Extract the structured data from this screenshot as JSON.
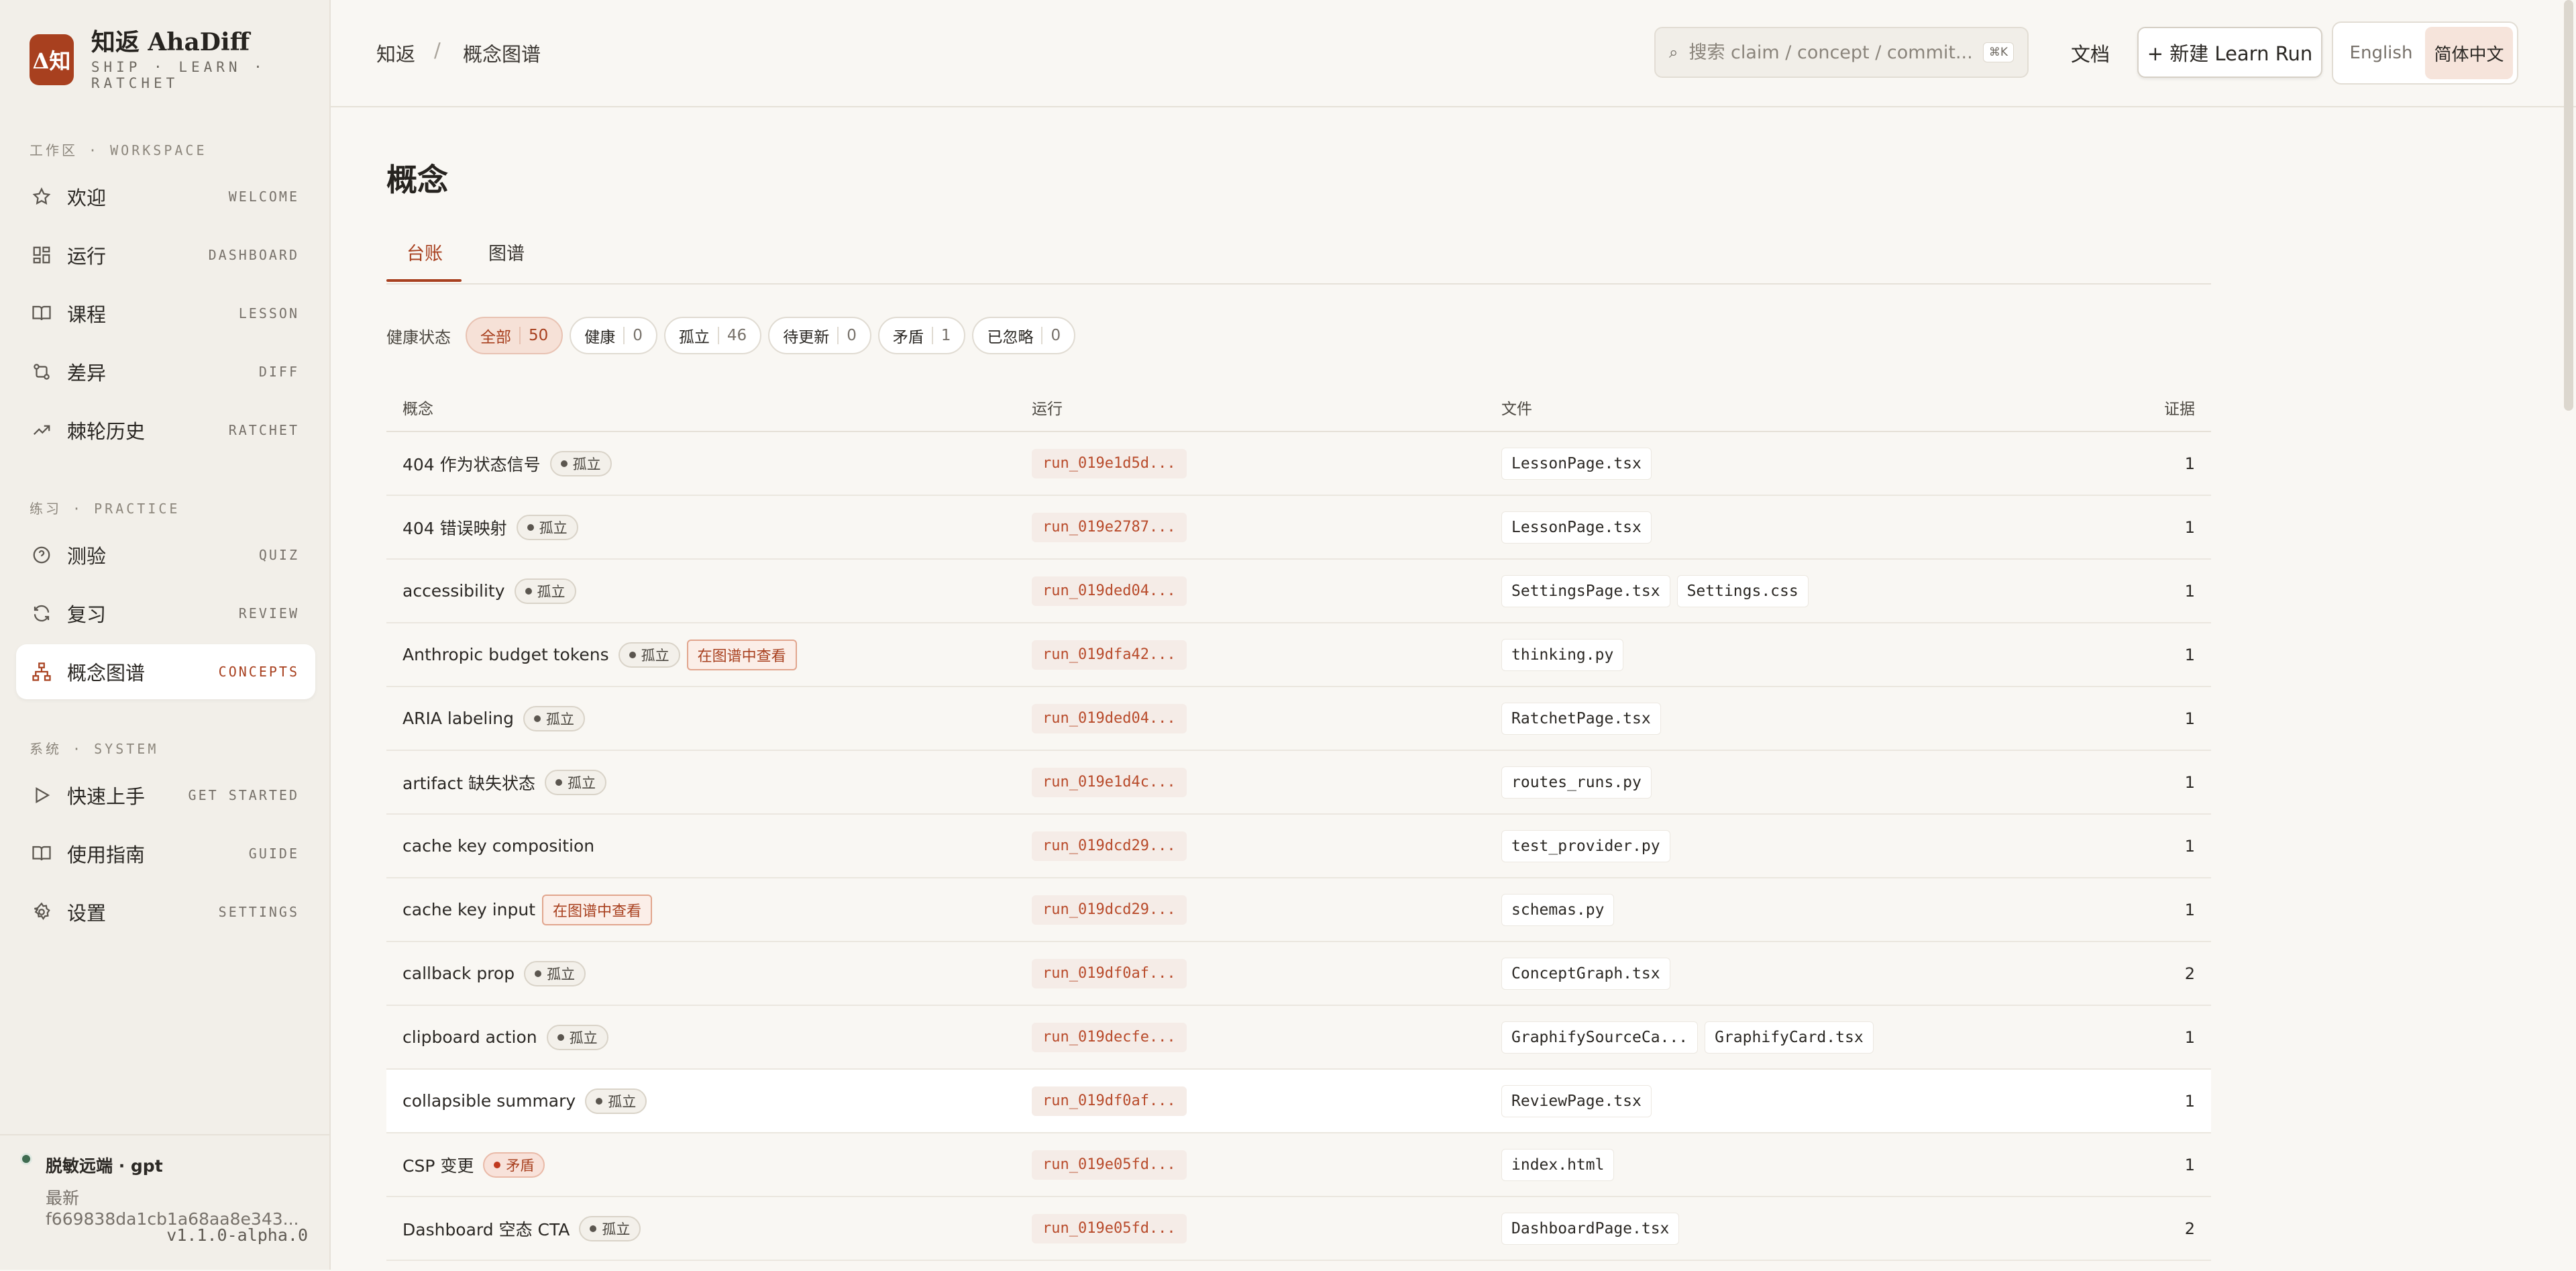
{
  "brand": {
    "logo": "Δ知",
    "name": "知返 AhaDiff",
    "tagline": "SHIP · LEARN · RATCHET"
  },
  "sidebar": {
    "sections": [
      {
        "label": "工作区 · WORKSPACE"
      },
      {
        "label": "练习 · PRACTICE"
      },
      {
        "label": "系统 · SYSTEM"
      }
    ],
    "items": [
      {
        "label": "欢迎",
        "en": "WELCOME",
        "icon": "star-icon"
      },
      {
        "label": "运行",
        "en": "DASHBOARD",
        "icon": "grid-icon"
      },
      {
        "label": "课程",
        "en": "LESSON",
        "icon": "book-icon"
      },
      {
        "label": "差异",
        "en": "DIFF",
        "icon": "diff-icon"
      },
      {
        "label": "棘轮历史",
        "en": "RATCHET",
        "icon": "trend-icon"
      },
      {
        "label": "测验",
        "en": "QUIZ",
        "icon": "question-icon"
      },
      {
        "label": "复习",
        "en": "REVIEW",
        "icon": "refresh-icon"
      },
      {
        "label": "概念图谱",
        "en": "CONCEPTS",
        "icon": "graph-icon",
        "active": true
      },
      {
        "label": "快速上手",
        "en": "GET STARTED",
        "icon": "play-icon"
      },
      {
        "label": "使用指南",
        "en": "GUIDE",
        "icon": "book-icon"
      },
      {
        "label": "设置",
        "en": "SETTINGS",
        "icon": "gear-icon"
      }
    ],
    "footer": {
      "status": "脱敏远端 · gpt",
      "commit": "最新 f669838da1cb1a68aa8e343...",
      "version": "v1.1.0-alpha.0"
    }
  },
  "header": {
    "breadcrumb": [
      "知返",
      "概念图谱"
    ],
    "breadcrumb_sep": "/",
    "search": {
      "placeholder": "搜索 claim / concept / commit...",
      "shortcut": "⌘K",
      "icon": "search-icon"
    },
    "docs": "文档",
    "new_run": "+ 新建 Learn Run",
    "languages": [
      "English",
      "简体中文"
    ],
    "active_language": "简体中文"
  },
  "main": {
    "title": "概念",
    "tabs": [
      "台账",
      "图谱"
    ],
    "filter_label": "健康状态",
    "filters": [
      {
        "label": "全部",
        "count": "50"
      },
      {
        "label": "健康",
        "count": "0"
      },
      {
        "label": "孤立",
        "count": "46"
      },
      {
        "label": "待更新",
        "count": "0"
      },
      {
        "label": "矛盾",
        "count": "1"
      },
      {
        "label": "已忽略",
        "count": "0"
      }
    ],
    "columns": [
      "概念",
      "运行",
      "文件",
      "证据"
    ],
    "view_in_graph": "在图谱中查看",
    "rows": [
      {
        "concept": "404 作为状态信号",
        "badge": "孤立",
        "run": "run_019e1d5d...",
        "files": [
          "LessonPage.tsx"
        ],
        "evidence": "1"
      },
      {
        "concept": "404 错误映射",
        "badge": "孤立",
        "run": "run_019e2787...",
        "files": [
          "LessonPage.tsx"
        ],
        "evidence": "1"
      },
      {
        "concept": "accessibility",
        "badge": "孤立",
        "run": "run_019ded04...",
        "files": [
          "SettingsPage.tsx",
          "Settings.css"
        ],
        "evidence": "1"
      },
      {
        "concept": "Anthropic budget tokens",
        "badge": "孤立",
        "link": true,
        "run": "run_019dfa42...",
        "files": [
          "thinking.py"
        ],
        "evidence": "1"
      },
      {
        "concept": "ARIA labeling",
        "badge": "孤立",
        "run": "run_019ded04...",
        "files": [
          "RatchetPage.tsx"
        ],
        "evidence": "1"
      },
      {
        "concept": "artifact 缺失状态",
        "badge": "孤立",
        "run": "run_019e1d4c...",
        "files": [
          "routes_runs.py"
        ],
        "evidence": "1"
      },
      {
        "concept": "cache key composition",
        "badge": "",
        "run": "run_019dcd29...",
        "files": [
          "test_provider.py"
        ],
        "evidence": "1"
      },
      {
        "concept": "cache key input",
        "badge": "",
        "link": true,
        "run": "run_019dcd29...",
        "files": [
          "schemas.py"
        ],
        "evidence": "1"
      },
      {
        "concept": "callback prop",
        "badge": "孤立",
        "run": "run_019df0af...",
        "files": [
          "ConceptGraph.tsx"
        ],
        "evidence": "2"
      },
      {
        "concept": "clipboard action",
        "badge": "孤立",
        "run": "run_019decfe...",
        "files": [
          "GraphifySourceCa...",
          "GraphifyCard.tsx"
        ],
        "evidence": "1"
      },
      {
        "concept": "collapsible summary",
        "badge": "孤立",
        "run": "run_019df0af...",
        "files": [
          "ReviewPage.tsx"
        ],
        "evidence": "1",
        "highlight": true
      },
      {
        "concept": "CSP 变更",
        "badge": "矛盾",
        "conflict": true,
        "run": "run_019e05fd...",
        "files": [
          "index.html"
        ],
        "evidence": "1"
      },
      {
        "concept": "Dashboard 空态 CTA",
        "badge": "孤立",
        "run": "run_019e05fd...",
        "files": [
          "DashboardPage.tsx"
        ],
        "evidence": "2"
      }
    ]
  },
  "colors": {
    "accent": "#a8401f",
    "background": "#f9f7f3",
    "sidebar": "#f2efe9"
  }
}
